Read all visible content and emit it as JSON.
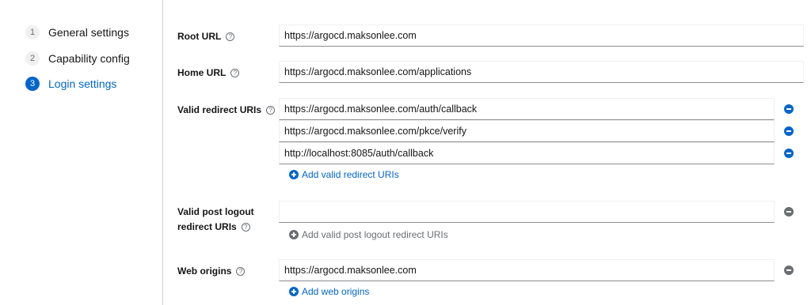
{
  "nav": {
    "steps": [
      {
        "num": "1",
        "label": "General settings"
      },
      {
        "num": "2",
        "label": "Capability config"
      },
      {
        "num": "3",
        "label": "Login settings"
      }
    ]
  },
  "form": {
    "root_url": {
      "label": "Root URL",
      "value": "https://argocd.maksonlee.com"
    },
    "home_url": {
      "label": "Home URL",
      "value": "https://argocd.maksonlee.com/applications"
    },
    "valid_redirect": {
      "label": "Valid redirect URIs",
      "values": [
        "https://argocd.maksonlee.com/auth/callback",
        "https://argocd.maksonlee.com/pkce/verify",
        "http://localhost:8085/auth/callback"
      ],
      "add_label": "Add valid redirect URIs"
    },
    "post_logout": {
      "label_line1": "Valid post logout",
      "label_line2": "redirect URIs",
      "value": "",
      "add_label": "Add valid post logout redirect URIs"
    },
    "web_origins": {
      "label": "Web origins",
      "value": "https://argocd.maksonlee.com",
      "add_label": "Add web origins"
    }
  },
  "help_glyph": "?",
  "colors": {
    "accent": "#0066cc",
    "disabled": "#6a6e73",
    "border": "#8a8d90"
  }
}
